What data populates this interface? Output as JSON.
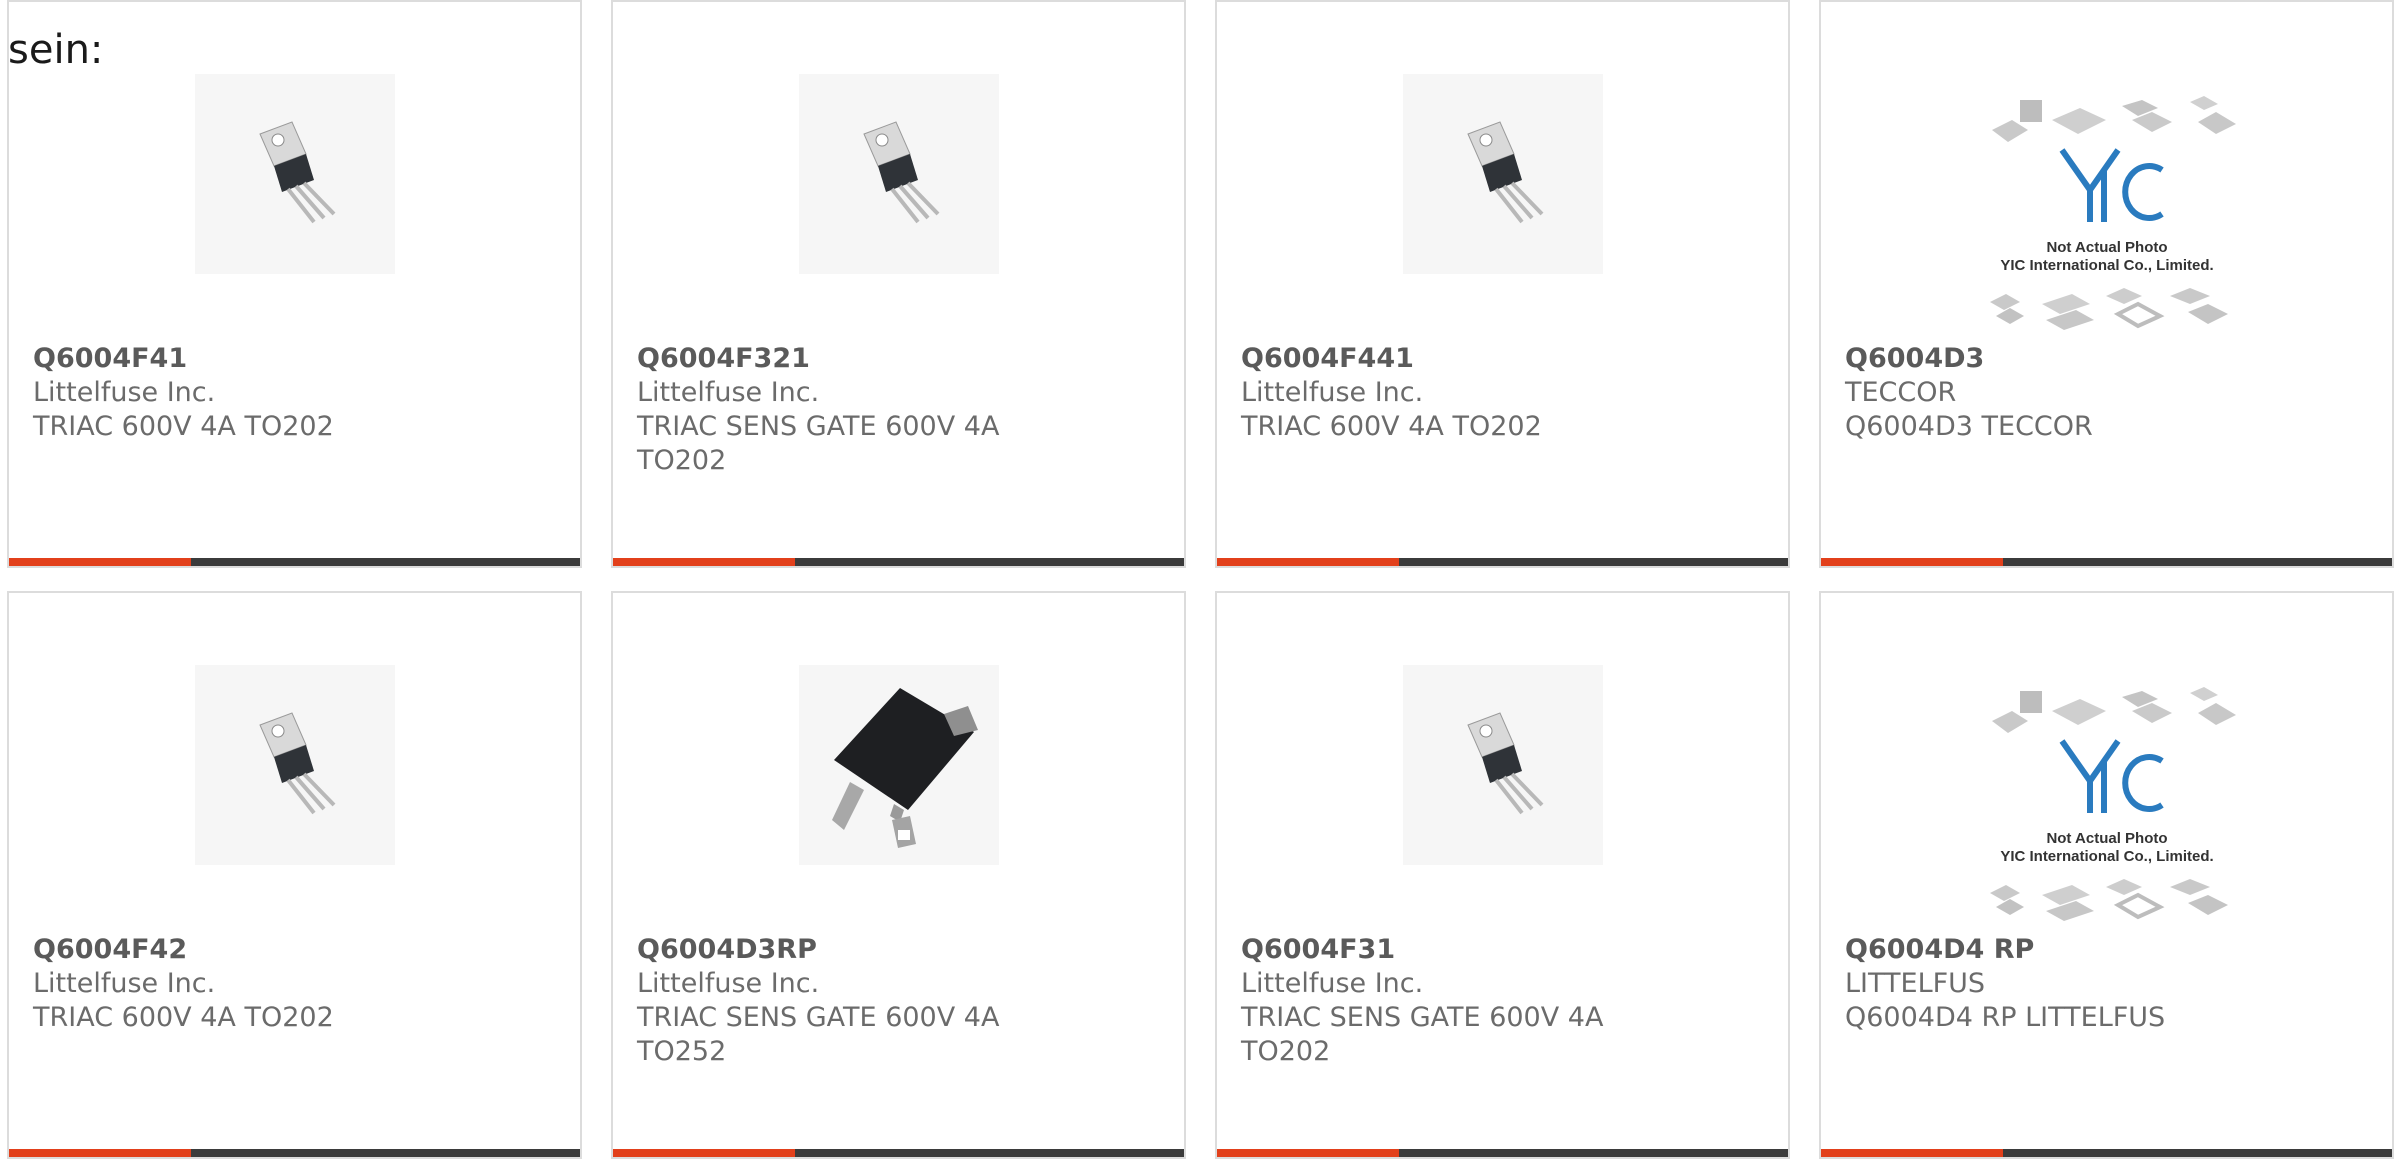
{
  "heading": "sein:",
  "colors": {
    "accent": "#e2401b",
    "bar": "#3b3b3b",
    "text": "#6b6b6b",
    "border": "#dcdcdc"
  },
  "products": [
    {
      "part": "Q6004F41",
      "manufacturer": "Littelfuse Inc.",
      "description": "TRIAC 600V 4A TO202",
      "image": "to202-transistor-image"
    },
    {
      "part": "Q6004F321",
      "manufacturer": "Littelfuse Inc.",
      "description": "TRIAC SENS GATE 600V 4A TO202",
      "image": "to202-transistor-image"
    },
    {
      "part": "Q6004F441",
      "manufacturer": "Littelfuse Inc.",
      "description": "TRIAC 600V 4A TO202",
      "image": "to202-transistor-image"
    },
    {
      "part": "Q6004D3",
      "manufacturer": "TECCOR",
      "description": "Q6004D3 TECCOR",
      "image": "not-actual-photo-image",
      "watermark": [
        "Not Actual Photo",
        "YIC International Co., Limited."
      ]
    },
    {
      "part": "Q6004F42",
      "manufacturer": "Littelfuse Inc.",
      "description": "TRIAC 600V 4A TO202",
      "image": "to202-transistor-image"
    },
    {
      "part": "Q6004D3RP",
      "manufacturer": "Littelfuse Inc.",
      "description": "TRIAC SENS GATE 600V 4A TO252",
      "image": "to252-package-image"
    },
    {
      "part": "Q6004F31",
      "manufacturer": "Littelfuse Inc.",
      "description": "TRIAC SENS GATE 600V 4A TO202",
      "image": "to202-transistor-image"
    },
    {
      "part": "Q6004D4 RP",
      "manufacturer": "LITTELFUS",
      "description": "Q6004D4 RP LITTELFUS",
      "image": "not-actual-photo-image",
      "watermark": [
        "Not Actual Photo",
        "YIC International Co., Limited."
      ]
    }
  ]
}
